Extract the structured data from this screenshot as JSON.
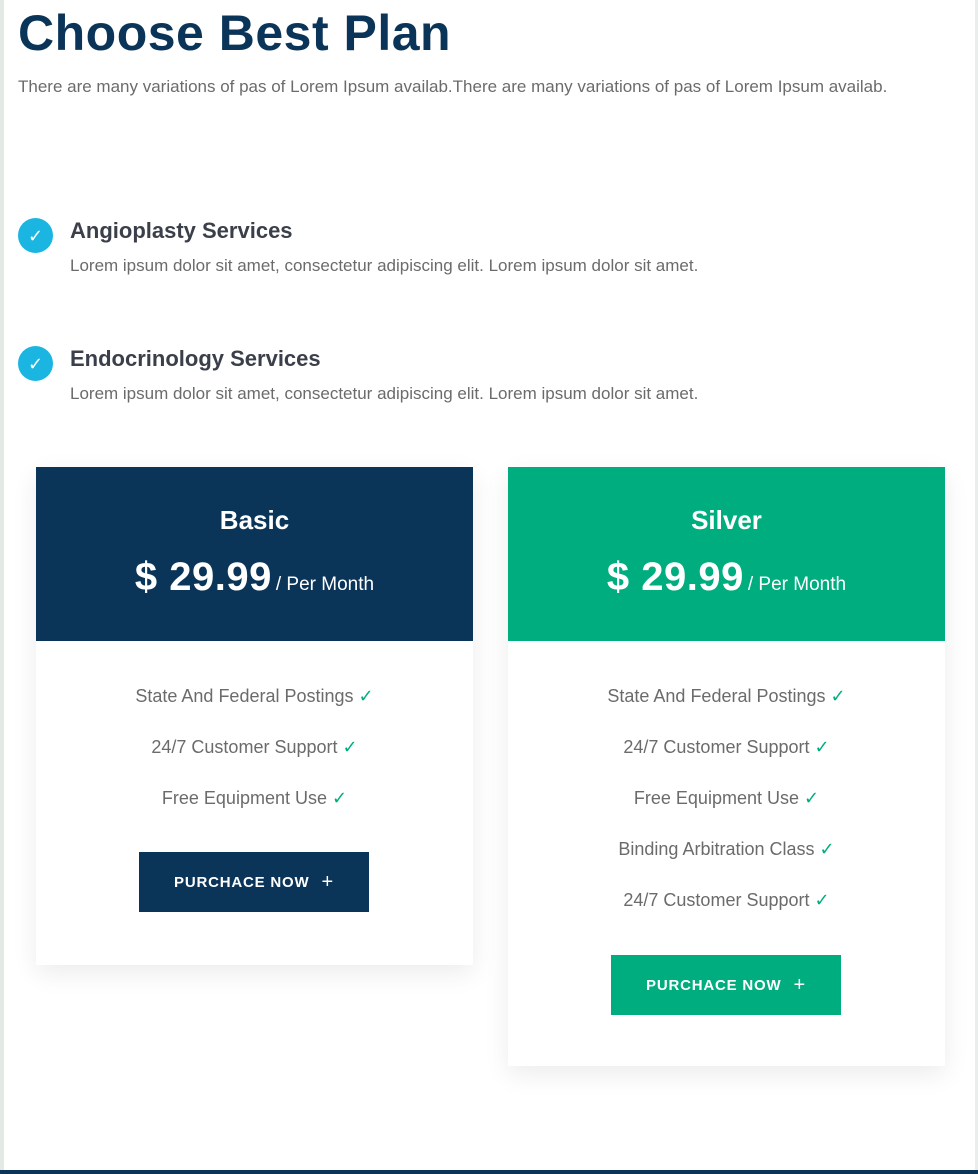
{
  "header": {
    "title": "Choose Best Plan",
    "intro": "There are many variations of pas of Lorem Ipsum availab.There are many variations of pas of Lorem Ipsum availab."
  },
  "services": [
    {
      "icon": "check-circle-icon",
      "title": "Angioplasty Services",
      "description": "Lorem ipsum dolor sit amet, consectetur adipiscing elit. Lorem ipsum dolor sit amet."
    },
    {
      "icon": "check-circle-icon",
      "title": "Endocrinology Services",
      "description": "Lorem ipsum dolor sit amet, consectetur adipiscing elit. Lorem ipsum dolor sit amet."
    }
  ],
  "plans": [
    {
      "name": "Basic",
      "price": "$ 29.99",
      "period": "/ Per Month",
      "color": "#0b3558",
      "features": [
        "State And Federal Postings",
        "24/7 Customer Support",
        "Free Equipment Use"
      ],
      "button_label": "PURCHACE NOW"
    },
    {
      "name": "Silver",
      "price": "$ 29.99",
      "period": "/ Per Month",
      "color": "#00ad7f",
      "features": [
        "State And Federal Postings",
        "24/7 Customer Support",
        "Free Equipment Use",
        "Binding Arbitration Class",
        "24/7 Customer Support"
      ],
      "button_label": "PURCHACE NOW"
    }
  ],
  "icons": {
    "check": "✓",
    "plus": "+"
  },
  "colors": {
    "navy": "#0b3558",
    "green": "#00ad7f",
    "cyan": "#1ab5e0"
  }
}
